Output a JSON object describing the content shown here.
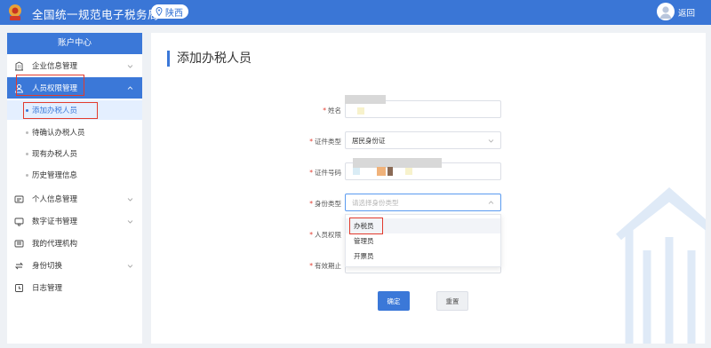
{
  "header": {
    "app_title": "全国统一规范电子税务局",
    "region": "陕西",
    "back_label": "返回"
  },
  "sidebar": {
    "title": "账户中心",
    "items": [
      {
        "label": "企业信息管理",
        "icon": "building-icon",
        "expandable": true
      },
      {
        "label": "人员权限管理",
        "icon": "users-icon",
        "expandable": true,
        "active": true
      },
      {
        "label": "个人信息管理",
        "icon": "id-card-icon",
        "expandable": true
      },
      {
        "label": "数字证书管理",
        "icon": "certificate-icon",
        "expandable": true
      },
      {
        "label": "我的代理机构",
        "icon": "agency-icon",
        "expandable": false
      },
      {
        "label": "身份切换",
        "icon": "switch-icon",
        "expandable": true
      },
      {
        "label": "日志管理",
        "icon": "log-icon",
        "expandable": false
      }
    ],
    "sub_items": [
      {
        "label": "添加办税人员",
        "active": true
      },
      {
        "label": "待确认办税人员"
      },
      {
        "label": "现有办税人员"
      },
      {
        "label": "历史管理信息"
      }
    ]
  },
  "main": {
    "page_title": "添加办税人员",
    "form": {
      "name_label": "姓名",
      "id_type_label": "证件类型",
      "id_type_value": "居民身份证",
      "id_number_label": "证件号码",
      "identity_type_label": "身份类型",
      "identity_type_placeholder": "请选择身份类型",
      "permission_label": "人员权限",
      "valid_until_label": "有效期止",
      "identity_options": [
        "办税员",
        "管理员",
        "开票员"
      ]
    },
    "confirm_label": "确定",
    "reset_label": "重置"
  },
  "colors": {
    "brand": "#3a76d6",
    "active_bg": "#3b78d8",
    "highlight_box": "#e23b2e",
    "required": "#e23b2e"
  }
}
